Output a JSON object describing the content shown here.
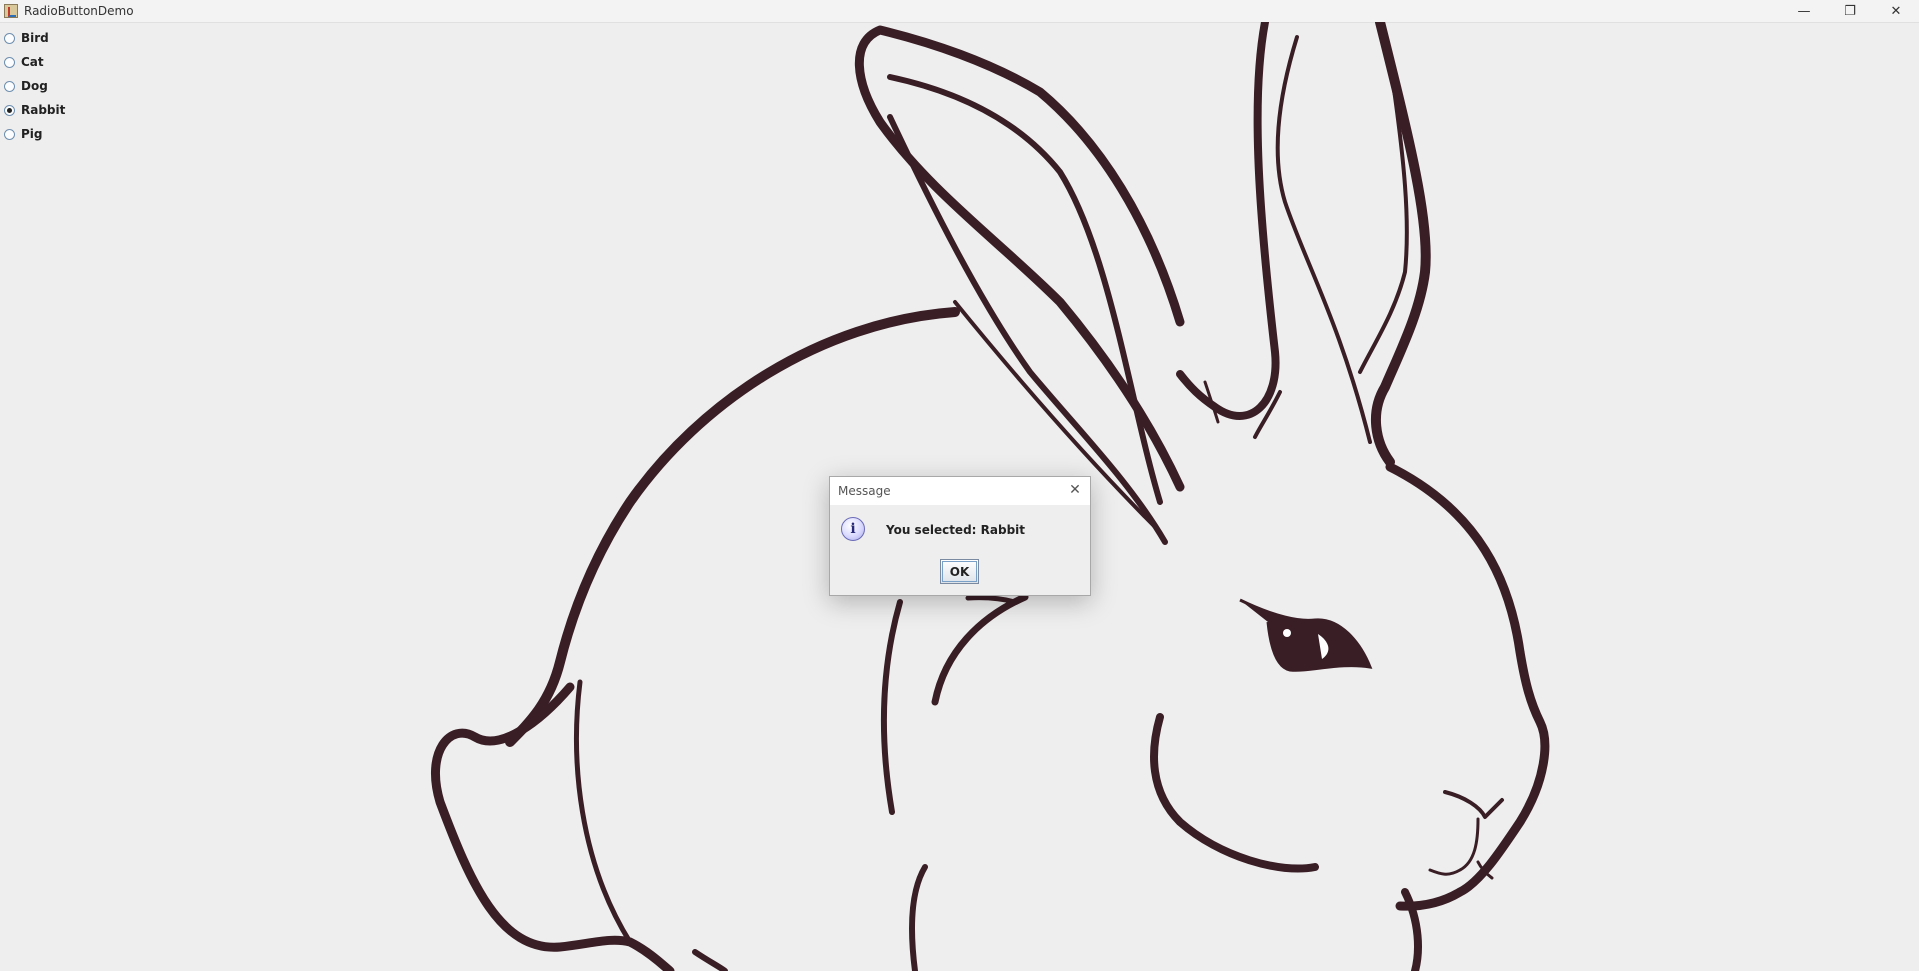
{
  "window": {
    "title": "RadioButtonDemo",
    "minimize": "—",
    "maximize": "❐",
    "close": "✕"
  },
  "radios": [
    {
      "label": "Bird",
      "selected": false
    },
    {
      "label": "Cat",
      "selected": false
    },
    {
      "label": "Dog",
      "selected": false
    },
    {
      "label": "Rabbit",
      "selected": true
    },
    {
      "label": "Pig",
      "selected": false
    }
  ],
  "image": {
    "subject": "rabbit",
    "stroke_color": "#3a1e26"
  },
  "dialog": {
    "title": "Message",
    "message": "You selected: Rabbit",
    "ok_label": "OK",
    "close": "✕",
    "icon": "i"
  }
}
